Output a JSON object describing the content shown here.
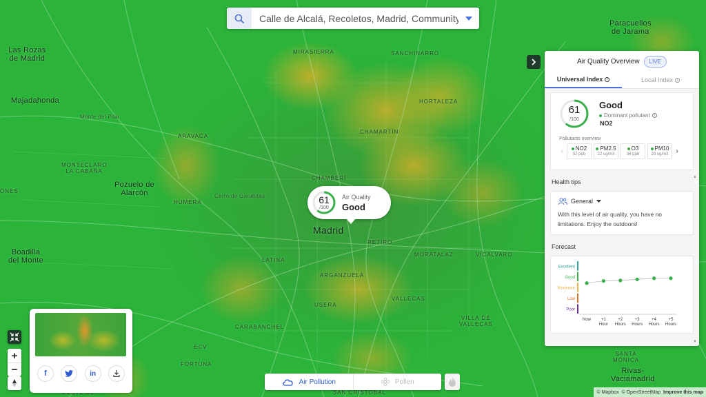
{
  "search": {
    "value": "Calle de Alcalá, Recoletos, Madrid, Community of Madrid"
  },
  "map_labels": {
    "las_rozas": "Las Rozas\nde Madrid",
    "majadahonda": "Majadahonda",
    "monte_del_pilar": "Monte del Pilar",
    "aravaca": "ARAVACA",
    "monteclaro": "MONTECLARO\nLA CABAÑA",
    "pozuelo": "Pozuelo de\nAlarcón",
    "humera": "HUMERA",
    "cerro_garabitas": "Cerro de Garabitas",
    "boadilla": "Boadilla\ndel Monte",
    "ones": "ONES",
    "mirasierra": "MIRASIERRA",
    "sanchinarro": "SANCHINARRO",
    "hortaleza": "HORTALEZA",
    "chamartin": "CHAMARTÍN",
    "chamberi": "CHAMBERÍ",
    "madrid": "Madrid",
    "retiro": "RETIRO",
    "moratalaz": "MORATALAZ",
    "vicalvaro": "VICALVARO",
    "latina": "LATINA",
    "arganzuela": "ARGANZUELA",
    "usera": "USERA",
    "vallecas": "VALLECAS",
    "villa_vallecas": "VILLA DE\nVALLECAS",
    "carabanchel": "CARABANCHEL",
    "ecv": "ECV",
    "fortuna": "FORTUNA",
    "santa_monica": "SANTA\nMÓNICA",
    "rivas": "Rivas-\nVaciamadrid",
    "paracuellos": "Paracuellos\nde Jarama",
    "san_cristobal": "SAN CRISTÓBAL",
    "deste_de": "DESTE DE"
  },
  "popup": {
    "aqi": "61",
    "scale": "/100",
    "title": "Air Quality",
    "status": "Good"
  },
  "panel": {
    "title": "Air Quality Overview",
    "live": "LIVE",
    "tabs": [
      "Universal Index",
      "Local Index"
    ],
    "index": {
      "aqi": "61",
      "scale": "/100",
      "status": "Good",
      "dominant_label": "Dominant pollutant",
      "dominant": "NO2"
    },
    "pollutants_label": "Pollutants overview",
    "pollutants": [
      {
        "name": "NO2",
        "value": "52 ppb"
      },
      {
        "name": "PM2.5",
        "value": "22 ug/m3"
      },
      {
        "name": "O3",
        "value": "36 ppb"
      },
      {
        "name": "PM10",
        "value": "29 ug/m3"
      }
    ],
    "health_title": "Health tips",
    "health_group": "General",
    "health_text": "With this level of air quality, you have no limitations. Enjoy the outdoors!",
    "forecast_title": "Forecast"
  },
  "chart_data": {
    "type": "line",
    "title": "Forecast",
    "categories": [
      "Now",
      "+1 Hour",
      "+2 Hours",
      "+3 Hours",
      "+4 Hours",
      "+5 Hours"
    ],
    "y_bands": [
      "Poor",
      "Low",
      "Moderate",
      "Good",
      "Excellent"
    ],
    "band_colors": [
      "#6b2fa0",
      "#e0732a",
      "#e8b24a",
      "#3ab04a",
      "#2f9f9a"
    ],
    "values": [
      58,
      62,
      63,
      65,
      67,
      67
    ],
    "ylim": [
      0,
      100
    ],
    "grid": false
  },
  "layers": {
    "air_pollution": "Air Pollution",
    "pollen": "Pollen"
  },
  "attribution": {
    "mapbox": "© Mapbox",
    "osm": "© OpenStreetMap",
    "improve": "Improve this map"
  },
  "colors": {
    "accent": "#2f5ccf",
    "good": "#3ab04a",
    "map_green": "#2bb33a"
  }
}
